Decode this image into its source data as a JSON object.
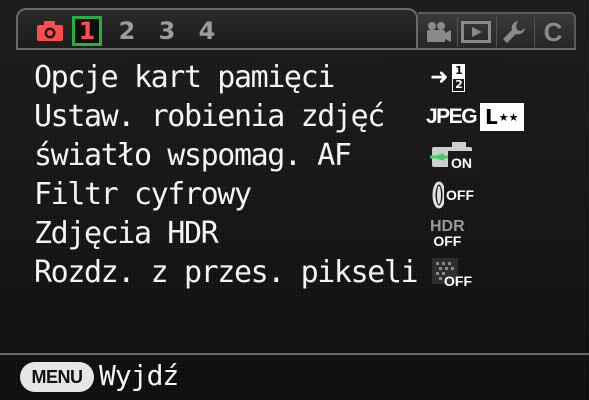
{
  "tabs": {
    "camera_icon": "camera-icon",
    "numbered": [
      "1",
      "2",
      "3",
      "4"
    ],
    "active_index": 0,
    "right_icons": [
      "movie-camera-icon",
      "playback-icon",
      "wrench-icon",
      "c-custom-icon"
    ],
    "right_labels": {
      "custom": "C"
    }
  },
  "menu": {
    "items": [
      {
        "label": "Opcje kart pamięci",
        "value_icon": "card-slot-icon",
        "value_digits": [
          "1",
          "2"
        ]
      },
      {
        "label": "Ustaw. robienia zdjęć",
        "value_text": "JPEG",
        "value_icon": "image-size-quality-icon",
        "size_letter": "L",
        "quality_mark": "★★"
      },
      {
        "label": "światło wspomag. AF",
        "value_icon": "af-assist-icon",
        "value_text": "ON"
      },
      {
        "label": "Filtr cyfrowy",
        "value_icon": "digital-filter-icon",
        "value_text": "OFF"
      },
      {
        "label": "Zdjęcia HDR",
        "value_icon": "hdr-icon",
        "hdr_text": "HDR",
        "value_text": "OFF"
      },
      {
        "label": "Rozdz. z przes. pikseli",
        "value_icon": "pixel-shift-icon",
        "value_text": "OFF"
      }
    ]
  },
  "footer": {
    "menu_button": "MENU",
    "exit_label": "Wyjdź"
  },
  "colors": {
    "active_tab_number": "#ff4b4b",
    "active_tab_border": "#25b13b",
    "camera_icon": "#ff4b4b",
    "af_icon_green": "#3bd45a"
  }
}
